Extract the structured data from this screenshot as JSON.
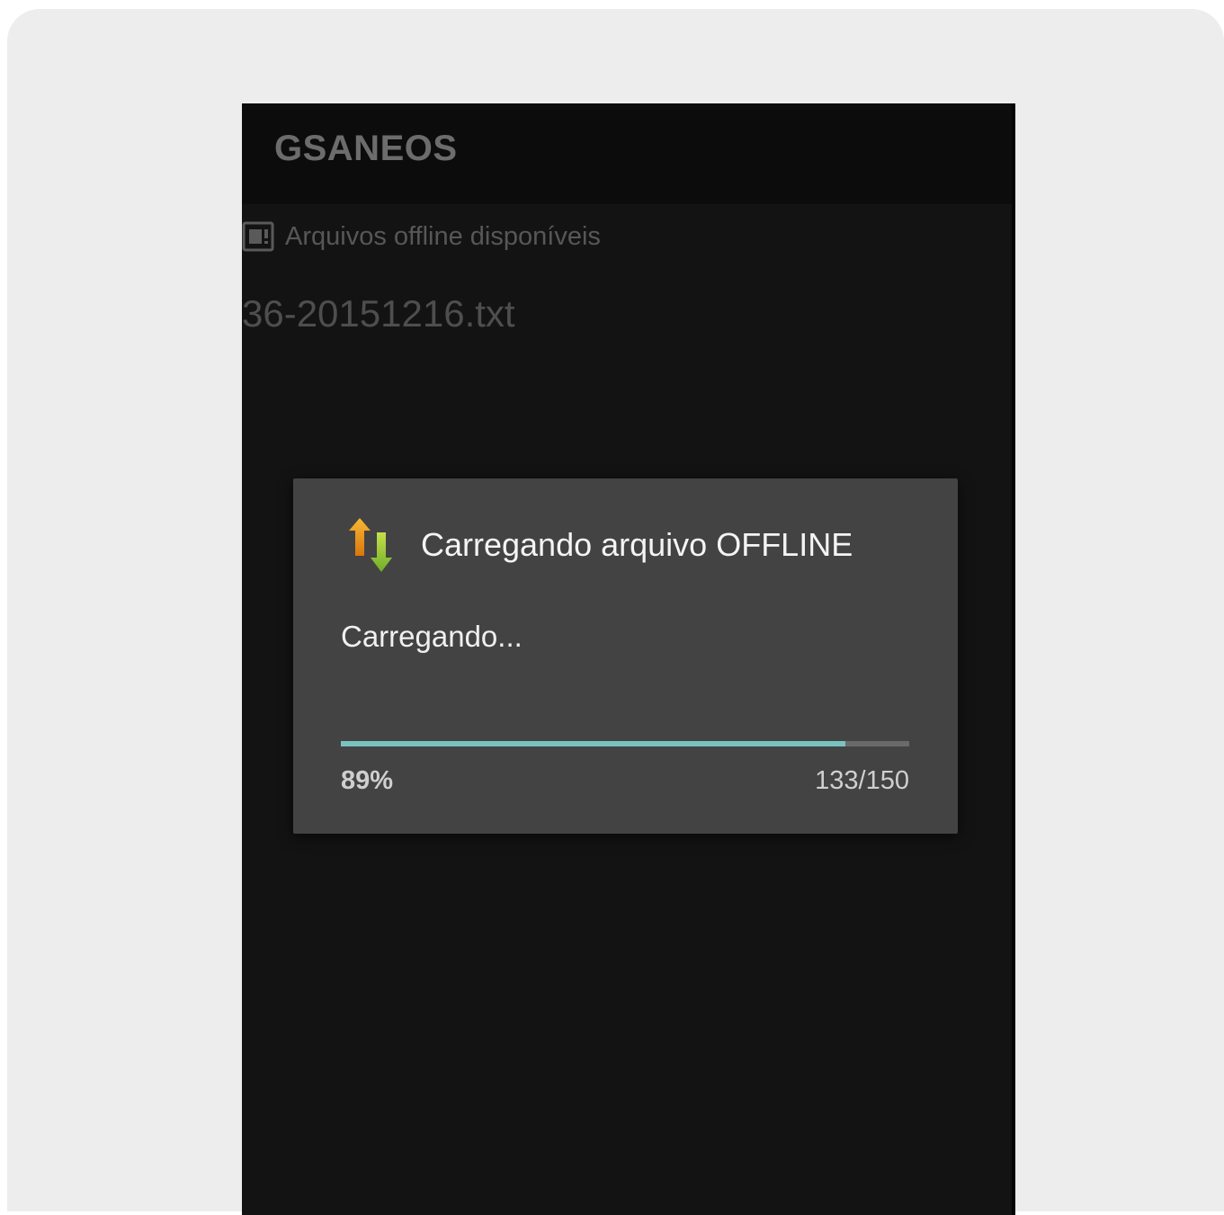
{
  "app": {
    "title": "GSANEOS"
  },
  "list": {
    "header_icon": "sd-card-icon",
    "header_label": "Arquivos offline disponíveis",
    "items": [
      {
        "label": "36-20151216.txt"
      }
    ]
  },
  "dialog": {
    "icon": "sync-arrows-icon",
    "title": "Carregando arquivo OFFLINE",
    "message": "Carregando...",
    "progress": {
      "fraction": 0.887,
      "percent_label": "89%",
      "count_label": "133/150"
    },
    "colors": {
      "progress": "#79c2c0",
      "arrow_up": "#f5a31a",
      "arrow_down": "#8cc63f"
    }
  }
}
